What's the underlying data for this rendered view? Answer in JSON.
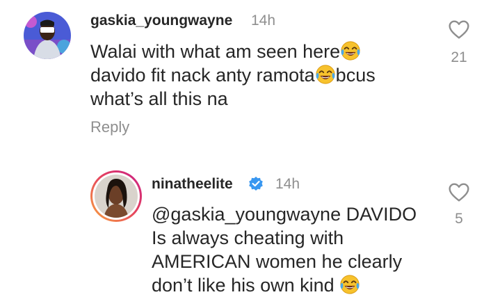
{
  "comments": [
    {
      "username": "gaskia_youngwayne",
      "time": "14h",
      "lines": [
        {
          "parts": [
            "Walai with what am seen here",
            "emoji",
            ""
          ]
        },
        {
          "parts": [
            "davido fit nack anty ramota",
            "emoji",
            "bcus"
          ]
        },
        {
          "parts": [
            "what’s all this na"
          ]
        }
      ],
      "reply_label": "Reply",
      "like_count": "21"
    },
    {
      "username": "ninatheelite",
      "verified": true,
      "time": "14h",
      "mention": "@gaskia_youngwayne",
      "line1_rest": " DAVIDO",
      "line2": "Is always cheating with",
      "line3": "AMERICAN women he clearly",
      "line4": "don’t like his own kind",
      "like_count": "5"
    }
  ],
  "colors": {
    "text": "#262626",
    "muted": "#8e8e8e",
    "verified": "#3897f0",
    "story_ring_start": "#f9a73e",
    "story_ring_end": "#c81f87"
  },
  "icons": [
    "heart-outline-icon",
    "verified-badge-icon",
    "face-with-tears-of-joy-emoji"
  ]
}
